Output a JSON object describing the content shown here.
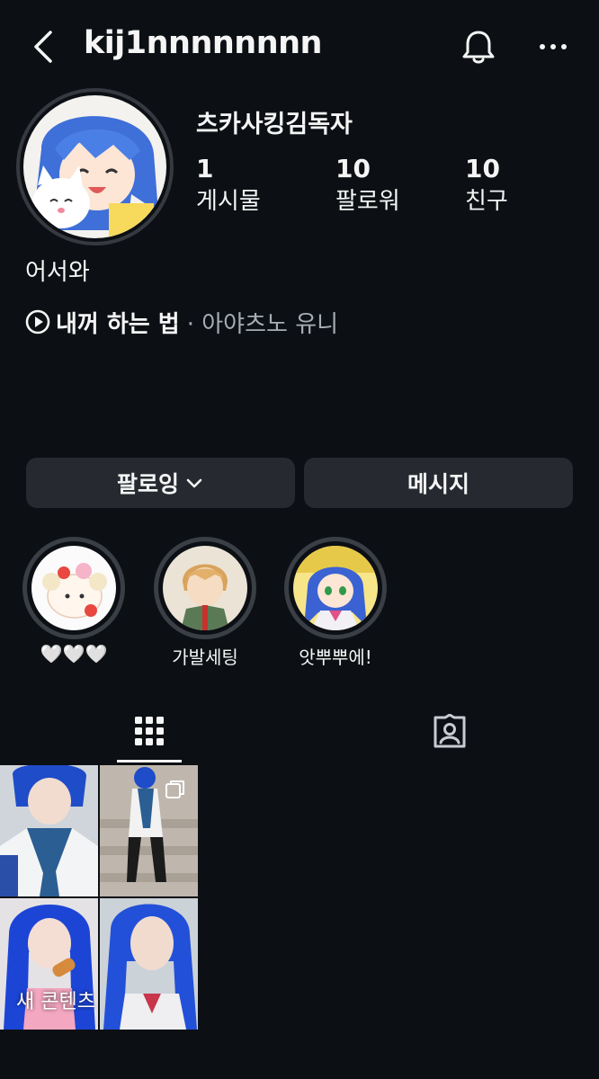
{
  "header": {
    "username": "kij1nnnnnnnn",
    "back_icon": "chevron-left-icon",
    "bell_icon": "bell-icon",
    "more_icon": "ellipsis-horizontal-icon"
  },
  "profile": {
    "display_name": "츠카사킹김독자",
    "stats": [
      {
        "value": "1",
        "label": "게시물"
      },
      {
        "value": "10",
        "label": "팔로워"
      },
      {
        "value": "10",
        "label": "친구"
      }
    ],
    "bio": "어서와",
    "music": {
      "icon": "play-circle-icon",
      "title": "내꺼 하는 법",
      "artist": "· 아야츠노 유니"
    }
  },
  "actions": {
    "follow_label": "팔로잉",
    "message_label": "메시지"
  },
  "highlights": [
    {
      "label": "🤍🤍🤍"
    },
    {
      "label": "가발세팅"
    },
    {
      "label": "앗뿌뿌에!"
    }
  ],
  "tabs": {
    "grid_icon": "grid-icon",
    "tagged_icon": "tagged-person-icon"
  },
  "posts": {
    "overlay_label": "새 콘텐츠"
  }
}
